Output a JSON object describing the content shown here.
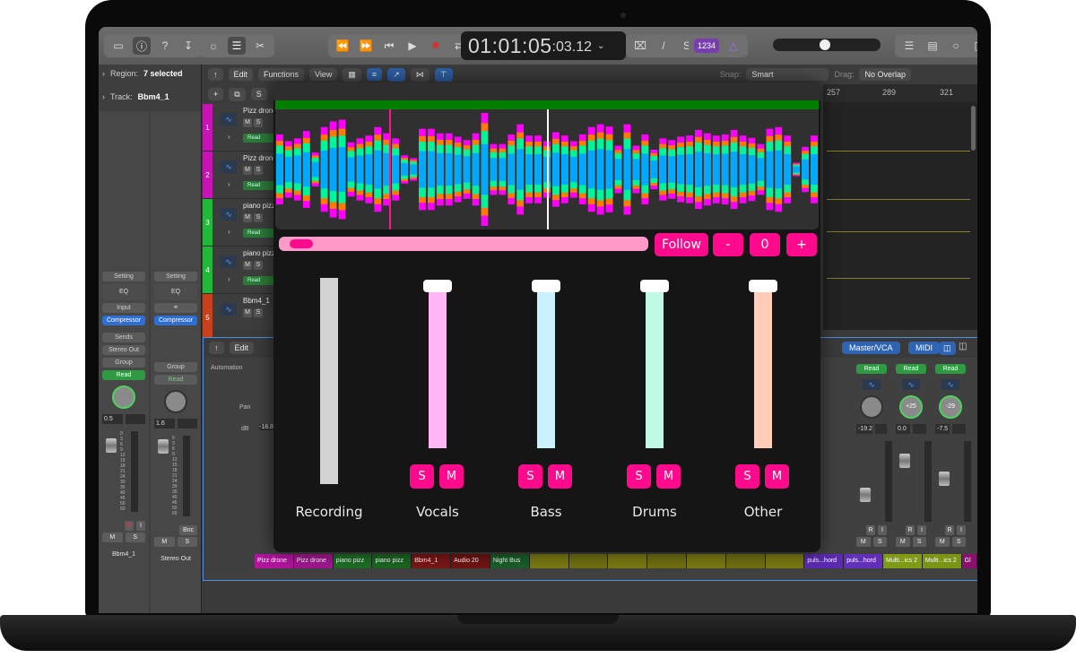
{
  "toolbar": {
    "left_icons": [
      "inbox-icon",
      "info-icon",
      "help-icon",
      "download-icon"
    ],
    "edit_icons": [
      "brightness-icon",
      "mixer-icon",
      "scissors-icon"
    ],
    "transport": [
      "rewind-icon",
      "fast-forward-icon",
      "go-to-start-icon",
      "play-icon",
      "record-icon",
      "cycle-icon"
    ],
    "lcd_main": "01:01:05",
    "lcd_sub": ":03.12",
    "count_in_badge": "1234",
    "right_icons": [
      "list-icon",
      "notepad-icon",
      "loops-icon",
      "browser-icon"
    ]
  },
  "inspector": {
    "region_label": "Region:",
    "region_value": "7 selected",
    "track_label": "Track:",
    "track_value": "Bbm4_1",
    "strips": [
      {
        "setting": "Setting",
        "eq": "EQ",
        "input": "Input",
        "plugin": "Compressor",
        "sends": "Sends",
        "output": "Stereo Out",
        "group": "Group",
        "automation": "Read",
        "pan_value": "0.5",
        "name": "Bbm4_1",
        "r": "R",
        "i": "I",
        "m": "M",
        "s": "S"
      },
      {
        "setting": "Setting",
        "eq": "EQ",
        "input": "",
        "plugin": "Compressor",
        "sends": "",
        "output": "",
        "group": "Group",
        "automation": "Read",
        "pan_value": "1.6",
        "name": "Stereo Out",
        "bnc": "Bnc",
        "m": "M",
        "s": "S"
      }
    ],
    "fader_scale": [
      "0",
      "3",
      "6",
      "9",
      "12",
      "15",
      "18",
      "21",
      "24",
      "30",
      "35",
      "40",
      "45",
      "50",
      "60"
    ]
  },
  "tracks_header": {
    "edit": "Edit",
    "functions": "Functions",
    "view": "View",
    "snap_label": "Snap:",
    "snap_value": "Smart",
    "drag_label": "Drag:",
    "drag_value": "No Overlap"
  },
  "tracks": [
    {
      "num": "1",
      "name": "Pizz drone",
      "color": "#c814b4",
      "m": "M",
      "s": "S",
      "automation": "Read"
    },
    {
      "num": "2",
      "name": "Pizz drone",
      "color": "#c814b4",
      "m": "M",
      "s": "S",
      "automation": "Read"
    },
    {
      "num": "3",
      "name": "piano pizz",
      "color": "#22b83a",
      "m": "M",
      "s": "S",
      "automation": "Read"
    },
    {
      "num": "4",
      "name": "piano pizz",
      "color": "#22b83a",
      "m": "M",
      "s": "S",
      "automation": "Read"
    },
    {
      "num": "5",
      "name": "Bbm4_1",
      "color": "#c8401c",
      "m": "M",
      "s": "S",
      "automation": ""
    }
  ],
  "ruler": [
    "257",
    "289",
    "321"
  ],
  "mixer": {
    "edit": "Edit",
    "automation_label": "Automation",
    "pan_label": "Pan",
    "db_label": "dB",
    "db_value": "-18.8",
    "tabs": [
      "Master/VCA",
      "MIDI"
    ],
    "right_strips": [
      {
        "automation": "Read",
        "pan": "",
        "db": "-19.2",
        "m": "M",
        "s": "S",
        "r": "R",
        "i": "I"
      },
      {
        "automation": "Read",
        "pan": "+25",
        "db": "0.0",
        "m": "M",
        "s": "S",
        "r": "R",
        "i": "I"
      },
      {
        "automation": "Read",
        "pan": "-29",
        "db": "-7.5",
        "m": "M",
        "s": "S",
        "r": "R",
        "i": "I"
      }
    ],
    "regions": [
      {
        "name": "Pizz drone",
        "color": "#b0169e"
      },
      {
        "name": "Pizz drone",
        "color": "#a01790"
      },
      {
        "name": "piano pizz",
        "color": "#1d6e24"
      },
      {
        "name": "piano pizz",
        "color": "#1a6620"
      },
      {
        "name": "Bbm4_1",
        "color": "#7a1616"
      },
      {
        "name": "Audio 20",
        "color": "#701414"
      },
      {
        "name": "Night Bus",
        "color": "#1a5e2a"
      },
      {
        "name": "",
        "color": "#7a7a12"
      },
      {
        "name": "",
        "color": "#707012"
      },
      {
        "name": "",
        "color": "#7a7a12"
      },
      {
        "name": "",
        "color": "#707012"
      },
      {
        "name": "",
        "color": "#7a7a12"
      },
      {
        "name": "",
        "color": "#707012"
      },
      {
        "name": "",
        "color": "#7a7a12"
      },
      {
        "name": "puls...hord",
        "color": "#5b2ab0"
      },
      {
        "name": "puls...hord",
        "color": "#6230b8"
      },
      {
        "name": "Multi...ics 2",
        "color": "#7f9a16"
      },
      {
        "name": "Multi...ics 2",
        "color": "#7a9416"
      },
      {
        "name": "Gl",
        "color": "#8a1070"
      }
    ]
  },
  "plugin": {
    "follow_label": "Follow",
    "minus_label": "-",
    "offset_value": "0",
    "plus_label": "+",
    "scrub_position": 0.02,
    "playhead_marker_fraction": 0.21,
    "playhead_fraction": 0.5,
    "colors": {
      "accent": "#ff0a8c",
      "timeline": "#007f00",
      "layer_vocals": "#ff00ff",
      "layer_other": "#ff7a00",
      "layer_drums": "#00f59a",
      "layer_bass": "#00a8ff"
    },
    "channels": [
      {
        "name": "Recording",
        "color": "#d3d3d3",
        "level": 1.0,
        "has_controls": false
      },
      {
        "name": "Vocals",
        "color": "#ffb6f5",
        "level": 1.0,
        "has_controls": true,
        "solo": "S",
        "mute": "M"
      },
      {
        "name": "Bass",
        "color": "#c9f1ff",
        "level": 1.0,
        "has_controls": true,
        "solo": "S",
        "mute": "M"
      },
      {
        "name": "Drums",
        "color": "#c0f9e4",
        "level": 1.0,
        "has_controls": true,
        "solo": "S",
        "mute": "M"
      },
      {
        "name": "Other",
        "color": "#ffcdb8",
        "level": 1.0,
        "has_controls": true,
        "solo": "S",
        "mute": "M"
      }
    ],
    "waveform_amplitudes": [
      0.62,
      0.5,
      0.55,
      0.68,
      0.3,
      0.75,
      0.85,
      0.88,
      0.48,
      0.55,
      0.6,
      0.75,
      0.64,
      0.55,
      0.25,
      0.2,
      0.72,
      0.72,
      0.64,
      0.64,
      0.58,
      0.52,
      0.64,
      1.0,
      0.45,
      0.45,
      0.62,
      0.8,
      0.6,
      0.6,
      0.5,
      0.66,
      0.6,
      0.5,
      0.62,
      0.75,
      0.8,
      0.76,
      0.42,
      0.8,
      0.42,
      0.62,
      0.35,
      0.55,
      0.52,
      0.58,
      0.6,
      0.7,
      0.64,
      0.6,
      0.62,
      0.7,
      0.6,
      0.56,
      0.45,
      0.72,
      0.75,
      0.6,
      0.12,
      0.4,
      0.6
    ]
  }
}
